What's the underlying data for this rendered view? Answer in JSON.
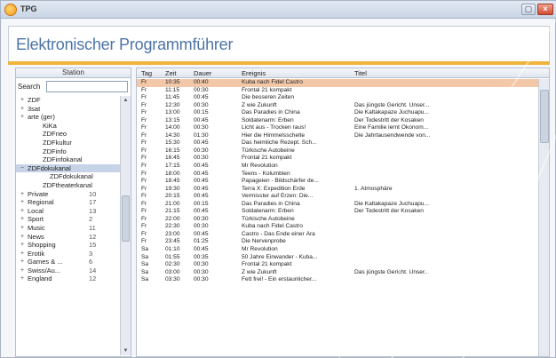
{
  "window": {
    "title": "TPG",
    "close_glyph": "×",
    "min_glyph": "▢",
    "app_icon": "epg-app-icon",
    "accent_color": "#f0b43a",
    "title_color": "#4c74a8"
  },
  "header": {
    "title": "Elektronischer Programmführer"
  },
  "stations_panel": {
    "heading": "Station",
    "search": {
      "label": "Search",
      "value": "",
      "placeholder": ""
    },
    "items": [
      {
        "expander": "+",
        "label": "ZDF",
        "count": "",
        "level": 1
      },
      {
        "expander": "+",
        "label": "3sat",
        "count": "",
        "level": 1
      },
      {
        "expander": "+",
        "label": "arte (ger)",
        "count": "",
        "level": 1
      },
      {
        "expander": "",
        "label": "KiKa",
        "count": "",
        "level": 2
      },
      {
        "expander": "",
        "label": "ZDFneo",
        "count": "",
        "level": 2
      },
      {
        "expander": "",
        "label": "ZDFkultur",
        "count": "",
        "level": 2
      },
      {
        "expander": "",
        "label": "ZDFinfo",
        "count": "",
        "level": 2
      },
      {
        "expander": "",
        "label": "ZDFinfokanal",
        "count": "",
        "level": 2
      },
      {
        "expander": "−",
        "label": "ZDFdokukanal",
        "count": "",
        "level": 1,
        "selected": true
      },
      {
        "expander": "",
        "label": "ZDFdokukanal",
        "count": "",
        "level": 3
      },
      {
        "expander": "",
        "label": "ZDFtheaterkanal",
        "count": "",
        "level": 2
      },
      {
        "expander": "+",
        "label": "Private",
        "count": "10",
        "level": 1
      },
      {
        "expander": "+",
        "label": "Regional",
        "count": "17",
        "level": 1
      },
      {
        "expander": "+",
        "label": "Local",
        "count": "13",
        "level": 1
      },
      {
        "expander": "+",
        "label": "Sport",
        "count": "2",
        "level": 1
      },
      {
        "expander": "+",
        "label": "Music",
        "count": "11",
        "level": 1
      },
      {
        "expander": "+",
        "label": "News",
        "count": "12",
        "level": 1
      },
      {
        "expander": "+",
        "label": "Shopping",
        "count": "15",
        "level": 1
      },
      {
        "expander": "+",
        "label": "Erotik",
        "count": "3",
        "level": 1
      },
      {
        "expander": "+",
        "label": "Games & ...",
        "count": "6",
        "level": 1
      },
      {
        "expander": "+",
        "label": "Swiss/Au...",
        "count": "14",
        "level": 1
      },
      {
        "expander": "+",
        "label": "England",
        "count": "12",
        "level": 1
      }
    ]
  },
  "grid": {
    "columns": {
      "tag": "Tag",
      "zeit": "Zeit",
      "dauer": "Dauer",
      "ereignis": "Ereignis",
      "titel": "Titel"
    },
    "rows": [
      {
        "tag": "Fr",
        "zeit": "10:35",
        "dauer": "00:40",
        "ereignis": "Kuba nach Fidel Castro",
        "titel": "",
        "selected": true
      },
      {
        "tag": "Fr",
        "zeit": "11:15",
        "dauer": "00:30",
        "ereignis": "Frontal 21 kompakt",
        "titel": ""
      },
      {
        "tag": "Fr",
        "zeit": "11:45",
        "dauer": "00:45",
        "ereignis": "Die besseren Zeiten",
        "titel": ""
      },
      {
        "tag": "Fr",
        "zeit": "12:30",
        "dauer": "00:30",
        "ereignis": "Z wie Zukunft",
        "titel": "Das jüngste Gericht. Unser..."
      },
      {
        "tag": "Fr",
        "zeit": "13:00",
        "dauer": "00:15",
        "ereignis": "Das Paradies in China",
        "titel": "Die Kaltakapaze Juchuapu..."
      },
      {
        "tag": "Fr",
        "zeit": "13:15",
        "dauer": "00:45",
        "ereignis": "Soldatenarm: Erben",
        "titel": "Der Todestritt der Kosaken"
      },
      {
        "tag": "Fr",
        "zeit": "14:00",
        "dauer": "00:30",
        "ereignis": "Licht aus - Trocken raus!",
        "titel": "Eine Familie lernt Ökonom..."
      },
      {
        "tag": "Fr",
        "zeit": "14:30",
        "dauer": "01:30",
        "ereignis": "Hier die Himmelsschelte",
        "titel": "Die Jahrtausendwende von..."
      },
      {
        "tag": "Fr",
        "zeit": "15:30",
        "dauer": "00:45",
        "ereignis": "Das heimliche Rezept. Sch...",
        "titel": ""
      },
      {
        "tag": "Fr",
        "zeit": "16:15",
        "dauer": "00:30",
        "ereignis": "Türkische Autobeine",
        "titel": ""
      },
      {
        "tag": "Fr",
        "zeit": "16:45",
        "dauer": "00:30",
        "ereignis": "Frontal 21 kompakt",
        "titel": ""
      },
      {
        "tag": "Fr",
        "zeit": "17:15",
        "dauer": "00:45",
        "ereignis": "Mr Revolution",
        "titel": ""
      },
      {
        "tag": "Fr",
        "zeit": "18:00",
        "dauer": "00:45",
        "ereignis": "Teens - Kolumbien",
        "titel": ""
      },
      {
        "tag": "Fr",
        "zeit": "18:45",
        "dauer": "00:45",
        "ereignis": "Papageien - Bildschärfer de...",
        "titel": ""
      },
      {
        "tag": "Fr",
        "zeit": "19:30",
        "dauer": "00:45",
        "ereignis": "Terra X: Expedition Erde",
        "titel": "1. Atmosphäre"
      },
      {
        "tag": "Fr",
        "zeit": "20:15",
        "dauer": "00:45",
        "ereignis": "Vermisster auf Erzen: Die...",
        "titel": ""
      },
      {
        "tag": "Fr",
        "zeit": "21:00",
        "dauer": "00:15",
        "ereignis": "Das Paradies in China",
        "titel": "Die Kaltakapaze Juchuapu..."
      },
      {
        "tag": "Fr",
        "zeit": "21:15",
        "dauer": "00:45",
        "ereignis": "Soldatenarm: Erben",
        "titel": "Der Todestritt der Kosaken"
      },
      {
        "tag": "Fr",
        "zeit": "22:00",
        "dauer": "00:30",
        "ereignis": "Türkische Autobeine",
        "titel": ""
      },
      {
        "tag": "Fr",
        "zeit": "22:30",
        "dauer": "00:30",
        "ereignis": "Kuba nach Fidel Castro",
        "titel": ""
      },
      {
        "tag": "Fr",
        "zeit": "23:00",
        "dauer": "00:45",
        "ereignis": "Castro - Das Ende einer Ära",
        "titel": ""
      },
      {
        "tag": "Fr",
        "zeit": "23:45",
        "dauer": "01:25",
        "ereignis": "Die Nervenprobe",
        "titel": ""
      },
      {
        "tag": "Sa",
        "zeit": "01:10",
        "dauer": "00:45",
        "ereignis": "Mr Revolution",
        "titel": ""
      },
      {
        "tag": "Sa",
        "zeit": "01:55",
        "dauer": "00:35",
        "ereignis": "50 Jahre Einwander - Kuba...",
        "titel": ""
      },
      {
        "tag": "Sa",
        "zeit": "02:30",
        "dauer": "00:30",
        "ereignis": "Frontal 21 kompakt",
        "titel": ""
      },
      {
        "tag": "Sa",
        "zeit": "03:00",
        "dauer": "00:30",
        "ereignis": "Z wie Zukunft",
        "titel": "Das jüngste Gericht. Unser..."
      },
      {
        "tag": "Sa",
        "zeit": "03:30",
        "dauer": "00:30",
        "ereignis": "Fett frei! - Ein erstaunlicher...",
        "titel": ""
      }
    ]
  }
}
